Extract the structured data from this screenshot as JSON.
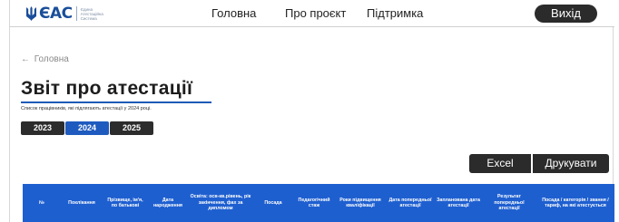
{
  "header": {
    "logo_text": "ЄАС",
    "logo_subtitle": "Єдина Атестаційна Система",
    "nav": [
      "Головна",
      "Про проєкт",
      "Підтримка"
    ],
    "logout_label": "Вихід"
  },
  "breadcrumb": {
    "arrow": "←",
    "label": "Головна"
  },
  "page": {
    "title": "Звіт про атестації",
    "subtitle": "Список працівників, які підлягають атестації у 2024 році."
  },
  "years": {
    "items": [
      "2023",
      "2024",
      "2025"
    ],
    "selected": "2024",
    "active_color": "#1f5bbf",
    "inactive_color": "#2c2c2c"
  },
  "actions": {
    "excel_label": "Excel",
    "print_label": "Друкувати"
  },
  "table": {
    "header_color": "#1e5fd0",
    "columns": [
      "№",
      "Поклікання",
      "Прізвище, ім'я, по батькові",
      "Дата народження",
      "Освіта: осв-кв.рівень, рік закінчення, фах за дипломом",
      "Посада",
      "Педагогічний стаж",
      "Роки підвищення кваліфікації",
      "Дата попередньої атестації",
      "Запланована дата атестації",
      "Результат попередньої атестації",
      "Посада / категорія / звання / тариф, на які атестується"
    ]
  }
}
